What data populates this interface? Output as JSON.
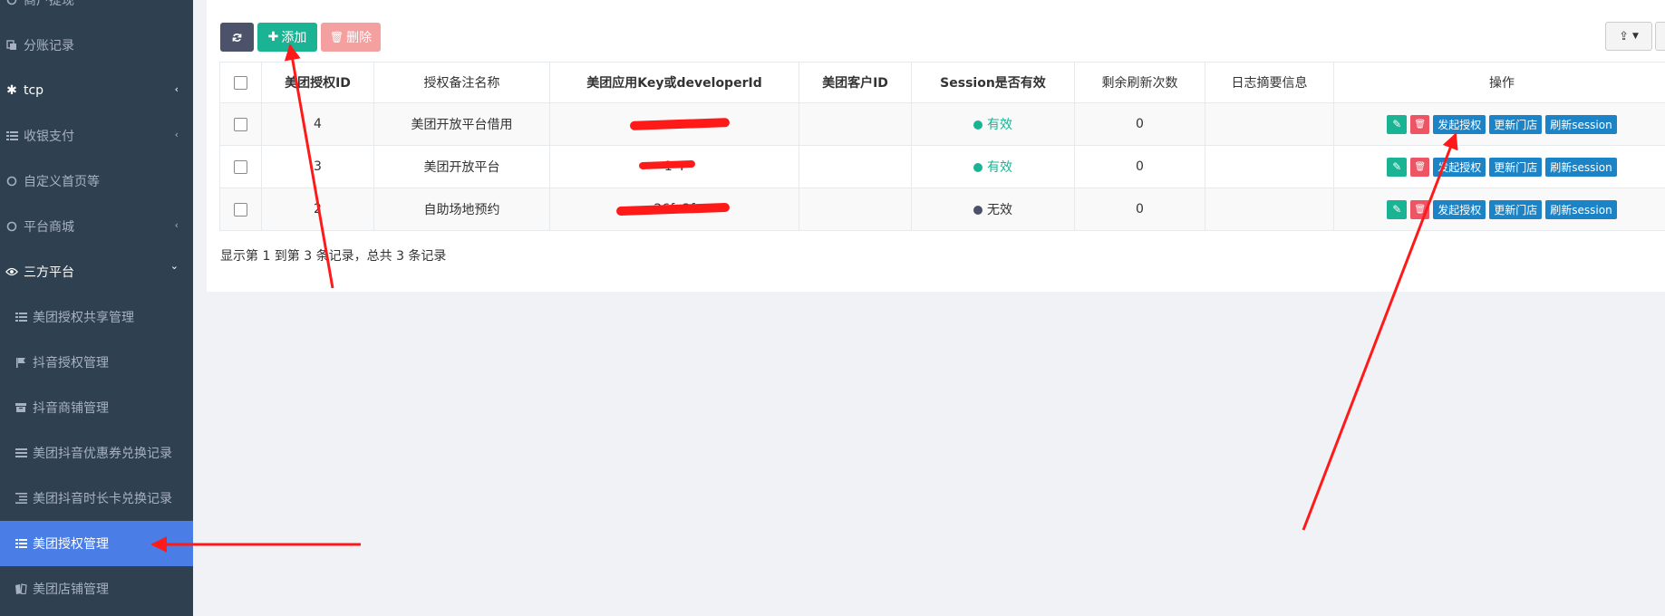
{
  "sidebar": {
    "items": [
      {
        "label": "商户提现",
        "icon": "circle-icon",
        "level": "top"
      },
      {
        "label": "分账记录",
        "icon": "copy-icon",
        "level": "top"
      },
      {
        "label": "tcp",
        "icon": "asterisk-icon",
        "level": "top",
        "caret": "‹"
      },
      {
        "label": "收银支付",
        "icon": "list-icon",
        "level": "top",
        "caret": "‹"
      },
      {
        "label": "自定义首页等",
        "icon": "circle-icon",
        "level": "top"
      },
      {
        "label": "平台商城",
        "icon": "circle-icon",
        "level": "top",
        "caret": "‹"
      },
      {
        "label": "三方平台",
        "icon": "eye-icon",
        "level": "top",
        "caret": "⌄"
      },
      {
        "label": "美团授权共享管理",
        "icon": "list-icon",
        "level": "sub"
      },
      {
        "label": "抖音授权管理",
        "icon": "flag-icon",
        "level": "sub"
      },
      {
        "label": "抖音商铺管理",
        "icon": "archive-icon",
        "level": "sub"
      },
      {
        "label": "美团抖音优惠券兑换记录",
        "icon": "bars-icon",
        "level": "sub"
      },
      {
        "label": "美团抖音时长卡兑换记录",
        "icon": "indent-icon",
        "level": "sub"
      },
      {
        "label": "美团授权管理",
        "icon": "list-icon",
        "level": "sub",
        "active": true
      },
      {
        "label": "美团店铺管理",
        "icon": "book-icon",
        "level": "sub"
      }
    ]
  },
  "toolbar": {
    "add_label": "添加",
    "delete_label": "删除"
  },
  "table": {
    "headers": [
      "美团授权ID",
      "授权备注名称",
      "美团应用Key或developerId",
      "美团客户ID",
      "Session是否有效",
      "剩余刷新次数",
      "日志摘要信息",
      "操作"
    ],
    "rows": [
      {
        "id": "4",
        "name": "美团开放平台借用",
        "key": "",
        "customer_id": "",
        "session": "有效",
        "session_valid": true,
        "refresh_count": "0",
        "log": ""
      },
      {
        "id": "3",
        "name": "美团开放平台",
        "key": "1    4",
        "customer_id": "",
        "session": "有效",
        "session_valid": true,
        "refresh_count": "0",
        "log": ""
      },
      {
        "id": "2",
        "name": "自助场地预约",
        "key": "    26fe3f    ",
        "customer_id": "",
        "session": "无效",
        "session_valid": false,
        "refresh_count": "0",
        "log": ""
      }
    ],
    "action_labels": {
      "authorize": "发起授权",
      "update_store": "更新门店",
      "refresh_session": "刷新session"
    }
  },
  "pagination": {
    "summary": "显示第 1 到第 3 条记录，总共 3 条记录"
  },
  "colors": {
    "sidebar_bg": "#2f4050",
    "sidebar_active": "#4a7de6",
    "primary_green": "#1ab394",
    "danger_red": "#ed5565",
    "action_blue": "#1c84c6",
    "annotation_red": "#ff1a1a"
  }
}
